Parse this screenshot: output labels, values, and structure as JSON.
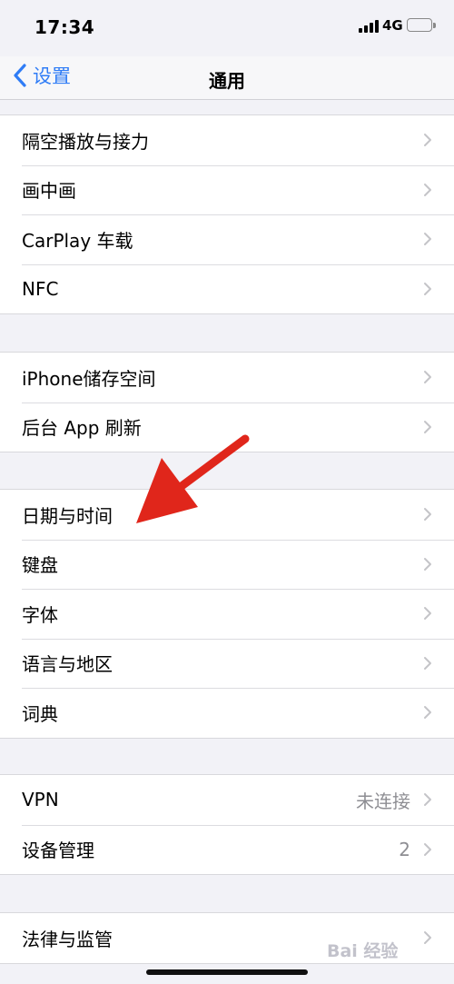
{
  "status_bar": {
    "time": "17:34",
    "network": "4G",
    "battery_level": 0.52,
    "battery_color": "#f5c60a"
  },
  "nav": {
    "back_label": "设置",
    "title": "通用",
    "accent_color": "#2f7cf6"
  },
  "groups": [
    {
      "items": [
        {
          "label": "隔空播放与接力",
          "value": ""
        },
        {
          "label": "画中画",
          "value": ""
        },
        {
          "label": "CarPlay 车载",
          "value": ""
        },
        {
          "label": "NFC",
          "value": ""
        }
      ]
    },
    {
      "items": [
        {
          "label": "iPhone储存空间",
          "value": ""
        },
        {
          "label": "后台 App 刷新",
          "value": ""
        }
      ]
    },
    {
      "items": [
        {
          "label": "日期与时间",
          "value": ""
        },
        {
          "label": "键盘",
          "value": ""
        },
        {
          "label": "字体",
          "value": ""
        },
        {
          "label": "语言与地区",
          "value": ""
        },
        {
          "label": "词典",
          "value": ""
        }
      ]
    },
    {
      "items": [
        {
          "label": "VPN",
          "value": "未连接"
        },
        {
          "label": "设备管理",
          "value": "2"
        }
      ]
    },
    {
      "items": [
        {
          "label": "法律与监管",
          "value": ""
        }
      ]
    }
  ],
  "annotation": {
    "arrow_color": "#e0261b",
    "target": "日期与时间"
  },
  "watermark": "Bai 经验"
}
